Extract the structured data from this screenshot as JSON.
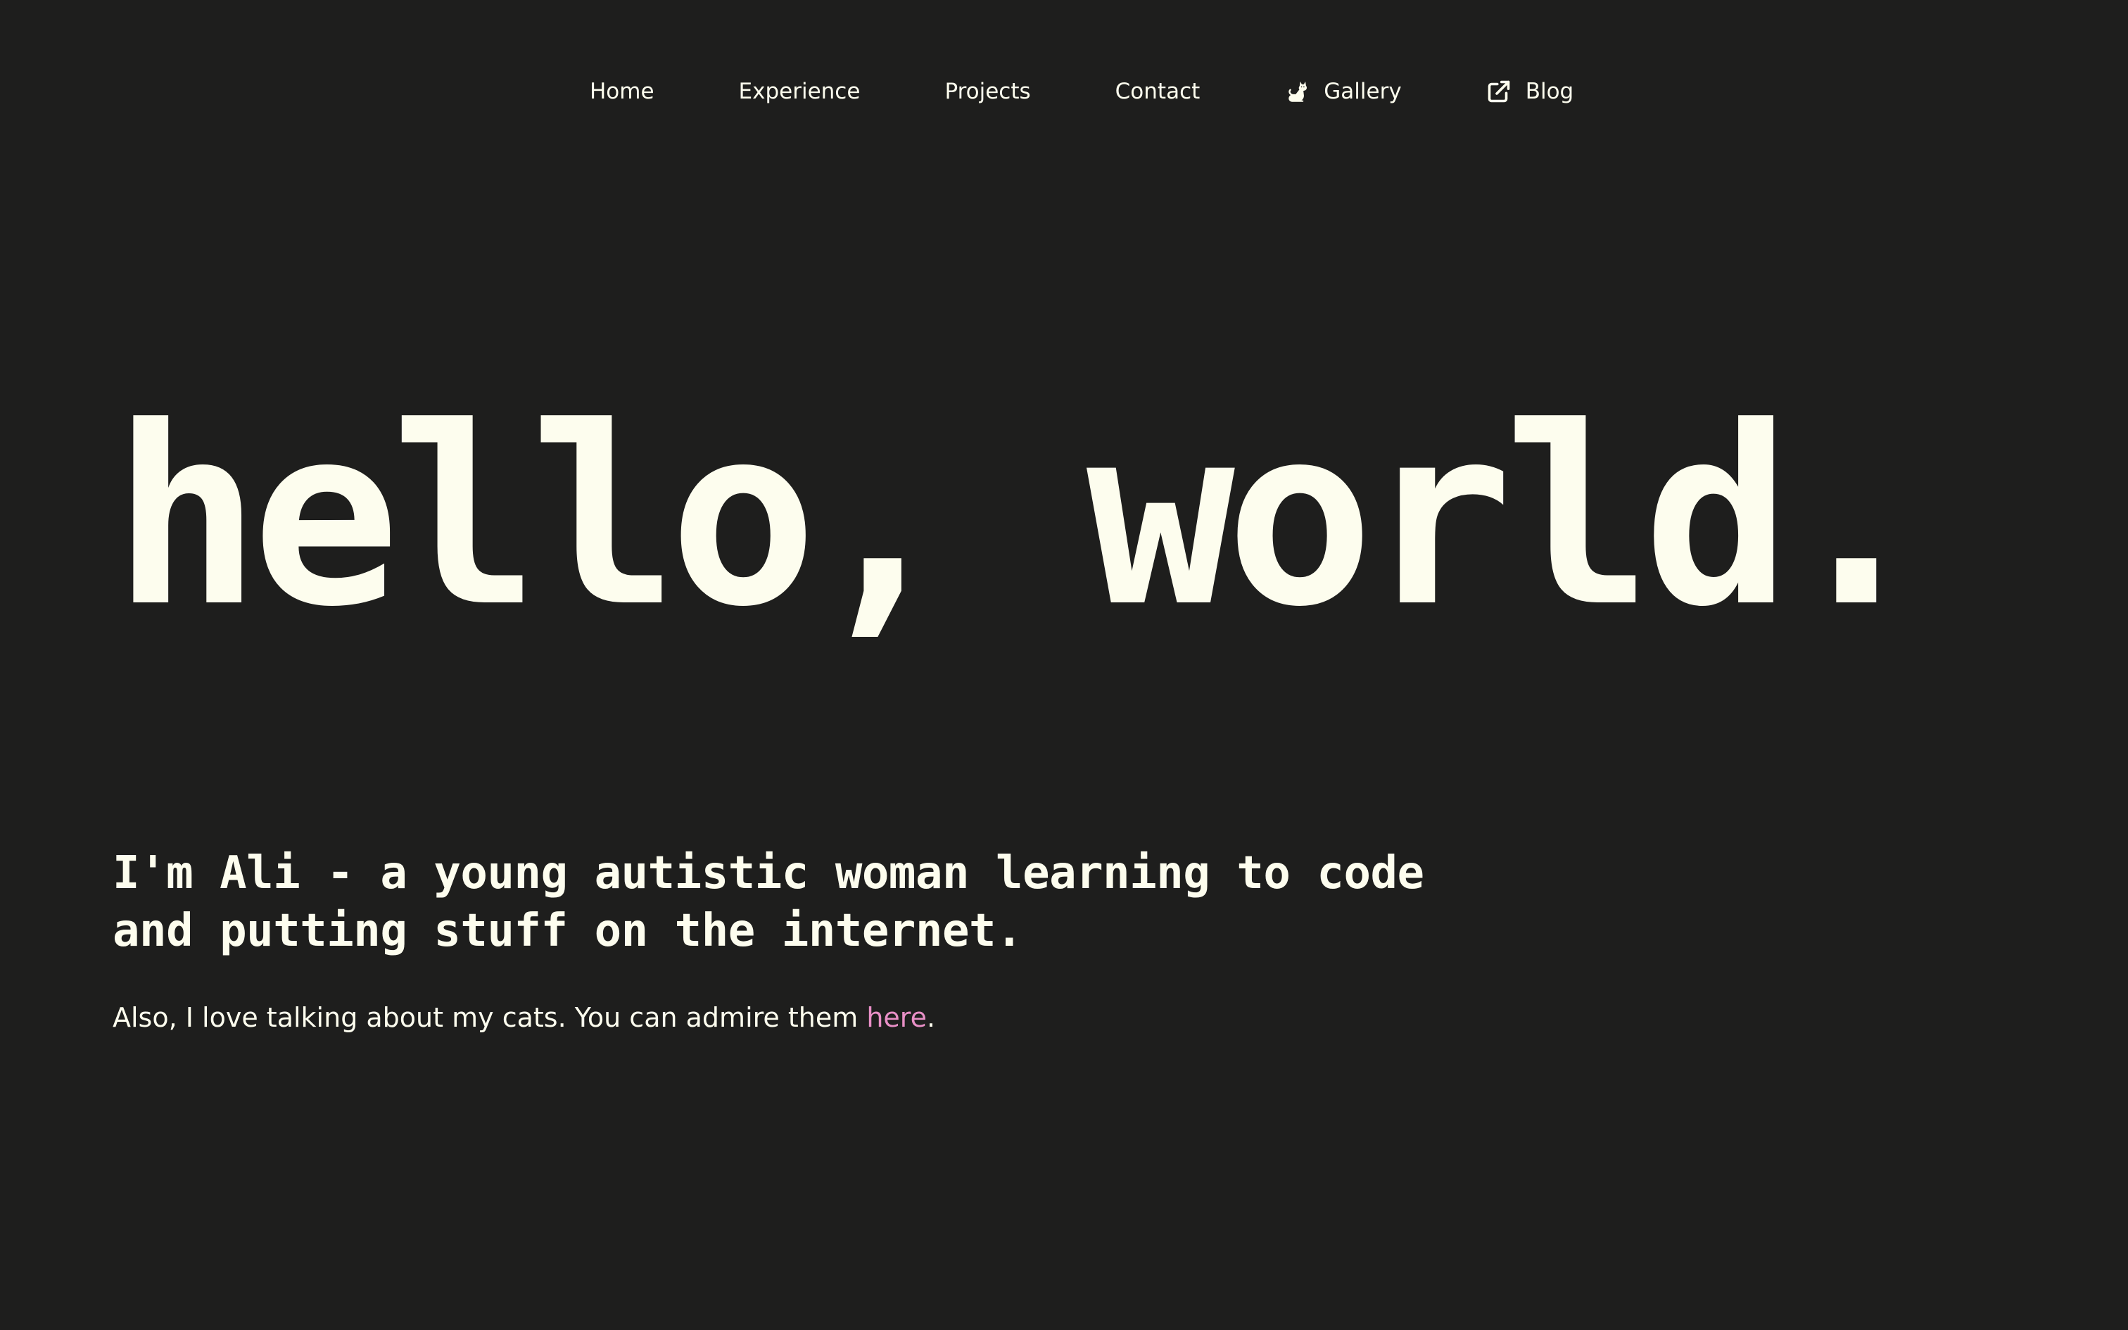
{
  "nav": {
    "items": [
      {
        "label": "Home",
        "icon": null
      },
      {
        "label": "Experience",
        "icon": null
      },
      {
        "label": "Projects",
        "icon": null
      },
      {
        "label": "Contact",
        "icon": null
      },
      {
        "label": "Gallery",
        "icon": "cat-icon"
      },
      {
        "label": "Blog",
        "icon": "external-link-icon"
      }
    ]
  },
  "hero": {
    "title": "hello, world."
  },
  "intro": {
    "line1": "I'm Ali - a young autistic woman learning to code",
    "line2": "and putting stuff on the internet."
  },
  "cats": {
    "text": "Also, I love talking about my cats. You can admire them ",
    "link_label": "here",
    "suffix": "."
  },
  "colors": {
    "background": "#1e1e1d",
    "text": "#fdfdee",
    "link": "#e88fc6"
  }
}
